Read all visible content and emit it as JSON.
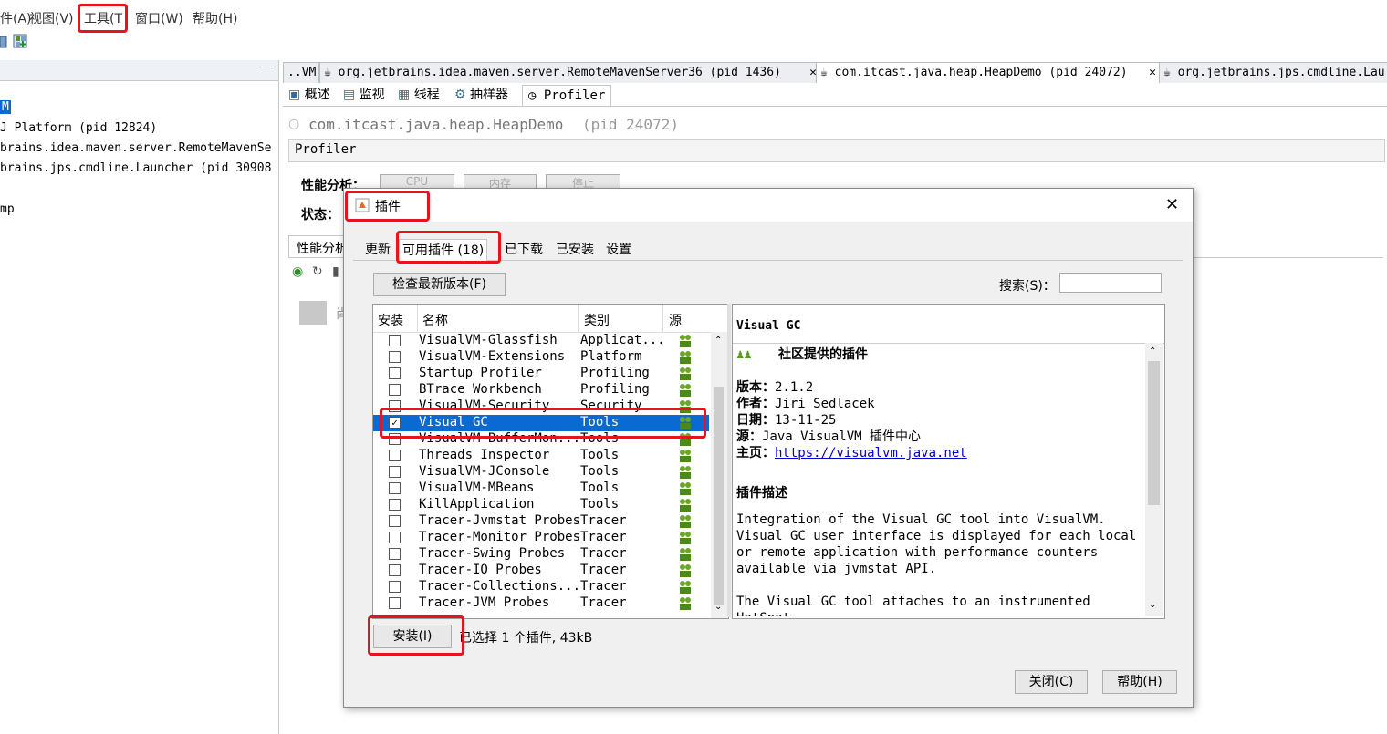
{
  "menubar": {
    "items": [
      "件(A)",
      "视图(V)",
      "工具(T",
      "窗口(W)",
      "帮助(H)"
    ]
  },
  "left_panel": {
    "minimize": "—",
    "items": [
      "M",
      "J Platform (pid 12824)",
      "brains.idea.maven.server.RemoteMavenSe",
      "brains.jps.cmdline.Launcher (pid 30908",
      "mp"
    ]
  },
  "doc_tabs": [
    {
      "label": "..VM"
    },
    {
      "label": "org.jetbrains.idea.maven.server.RemoteMavenServer36 (pid 1436)"
    },
    {
      "label": "com.itcast.java.heap.HeapDemo (pid 24072)"
    },
    {
      "label": "org.jetbrains.jps.cmdline.Lau"
    }
  ],
  "sub_tabs": [
    "概述",
    "监视",
    "线程",
    "抽样器",
    "Profiler"
  ],
  "app_title": "com.itcast.java.heap.HeapDemo",
  "app_pid": "(pid 24072)",
  "profiler_label": "Profiler",
  "profiling_label": "性能分析：",
  "profiling_buttons": [
    "CPU",
    "内存",
    "停止"
  ],
  "status_label": "状态：",
  "results_tab": "性能分析",
  "results_hint": "尚",
  "dialog": {
    "title": "插件",
    "close": "✕",
    "tabs": [
      "更新",
      "可用插件 (18)",
      "已下载",
      "已安装",
      "设置"
    ],
    "check_button": "检查最新版本(F)",
    "search_label": "搜索(S)：",
    "search_value": "",
    "columns": [
      "安装",
      "名称",
      "类别",
      "源"
    ],
    "plugins": [
      {
        "name": "VisualVM-Glassfish",
        "category": "Applicat...",
        "checked": false
      },
      {
        "name": "VisualVM-Extensions",
        "category": "Platform",
        "checked": false
      },
      {
        "name": "Startup Profiler",
        "category": "Profiling",
        "checked": false
      },
      {
        "name": "BTrace Workbench",
        "category": "Profiling",
        "checked": false
      },
      {
        "name": "VisualVM-Security",
        "category": "Security",
        "checked": false
      },
      {
        "name": "Visual GC",
        "category": "Tools",
        "checked": true
      },
      {
        "name": "VisualVM-BufferMon...",
        "category": "Tools",
        "checked": false
      },
      {
        "name": "Threads Inspector",
        "category": "Tools",
        "checked": false
      },
      {
        "name": "VisualVM-JConsole",
        "category": "Tools",
        "checked": false
      },
      {
        "name": "VisualVM-MBeans",
        "category": "Tools",
        "checked": false
      },
      {
        "name": "KillApplication",
        "category": "Tools",
        "checked": false
      },
      {
        "name": "Tracer-Jvmstat Probes",
        "category": "Tracer",
        "checked": false
      },
      {
        "name": "Tracer-Monitor Probes",
        "category": "Tracer",
        "checked": false
      },
      {
        "name": "Tracer-Swing Probes",
        "category": "Tracer",
        "checked": false
      },
      {
        "name": "Tracer-IO Probes",
        "category": "Tracer",
        "checked": false
      },
      {
        "name": "Tracer-Collections...",
        "category": "Tracer",
        "checked": false
      },
      {
        "name": "Tracer-JVM Probes",
        "category": "Tracer",
        "checked": false
      }
    ],
    "detail": {
      "header": "Visual GC",
      "community": "社区提供的插件",
      "version_label": "版本：",
      "version": "2.1.2",
      "author_label": "作者：",
      "author": "Jiri Sedlacek",
      "date_label": "日期：",
      "date": "13-11-25",
      "source_label": "源：",
      "source": "Java VisualVM 插件中心",
      "home_label": "主页：",
      "home": "https://visualvm.java.net",
      "desc_title": "插件描述",
      "desc_lines": [
        "Integration of the Visual GC tool into VisualVM.",
        "Visual GC user interface is displayed for each local",
        "or remote application with performance counters",
        "available via jvmstat API."
      ],
      "desc_line2": "The Visual GC tool attaches to an instrumented HotSpot"
    },
    "install_button": "安装(I)",
    "selection_info": "已选择 1 个插件, 43kB",
    "close_button": "关闭(C)",
    "help_button": "帮助(H)"
  }
}
